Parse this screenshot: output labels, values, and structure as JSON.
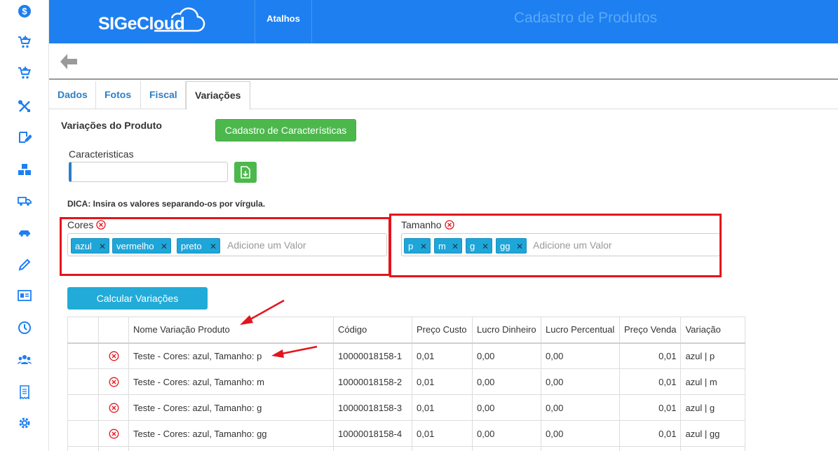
{
  "header": {
    "logo_text": "SIGeCloud",
    "atalhos_label": "Atalhos",
    "page_title": "Cadastro de Produtos"
  },
  "tabs": [
    {
      "label": "Dados"
    },
    {
      "label": "Fotos"
    },
    {
      "label": "Fiscal"
    },
    {
      "label": "Variações",
      "active": true
    }
  ],
  "content": {
    "section_title": "Variações do Produto",
    "cadastro_button": "Cadastro de Características",
    "caracteristicas_label": "Caracteristicas",
    "caracteristicas_value": "",
    "dica": "DICA: Insira os valores separando-os por vírgula.",
    "calcular_button": "Calcular Variações"
  },
  "characteristics": [
    {
      "name": "Cores",
      "values": [
        "azul",
        "vermelho",
        "preto"
      ],
      "placeholder": "Adicione um Valor"
    },
    {
      "name": "Tamanho",
      "values": [
        "p",
        "m",
        "g",
        "gg"
      ],
      "placeholder": "Adicione um Valor"
    }
  ],
  "table": {
    "headers": [
      "",
      "",
      "Nome Variação Produto",
      "Código",
      "Preço Custo",
      "Lucro Dinheiro",
      "Lucro Percentual",
      "Preço Venda",
      "Variação"
    ],
    "rows": [
      {
        "nome": "Teste - Cores: azul, Tamanho: p",
        "codigo": "10000018158-1",
        "preco_custo": "0,01",
        "lucro_dinheiro": "0,00",
        "lucro_percentual": "0,00",
        "preco_venda": "0,01",
        "variacao": "azul | p"
      },
      {
        "nome": "Teste - Cores: azul, Tamanho: m",
        "codigo": "10000018158-2",
        "preco_custo": "0,01",
        "lucro_dinheiro": "0,00",
        "lucro_percentual": "0,00",
        "preco_venda": "0,01",
        "variacao": "azul | m"
      },
      {
        "nome": "Teste - Cores: azul, Tamanho: g",
        "codigo": "10000018158-3",
        "preco_custo": "0,01",
        "lucro_dinheiro": "0,00",
        "lucro_percentual": "0,00",
        "preco_venda": "0,01",
        "variacao": "azul | g"
      },
      {
        "nome": "Teste - Cores: azul, Tamanho: gg",
        "codigo": "10000018158-4",
        "preco_custo": "0,01",
        "lucro_dinheiro": "0,00",
        "lucro_percentual": "0,00",
        "preco_venda": "0,01",
        "variacao": "azul | gg"
      }
    ]
  },
  "sidebar": {
    "icons": [
      "dollar-icon",
      "cart-add-icon",
      "cart-add-icon",
      "tools-icon",
      "edit-icon",
      "boxes-icon",
      "truck-icon",
      "car-icon",
      "pencil-icon",
      "id-card-icon",
      "clock-icon",
      "users-icon",
      "receipt-icon",
      "gear-icon"
    ]
  },
  "colors": {
    "header_blue": "#1e7ff0",
    "accent_green": "#4cb84c",
    "tag_blue": "#1fa6d9",
    "highlight_red": "#e3141b"
  }
}
